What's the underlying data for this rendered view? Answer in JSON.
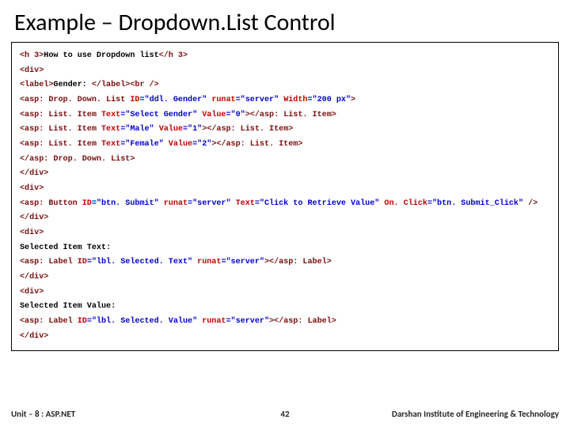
{
  "title": "Example – Dropdown.List Control",
  "footer": {
    "left": "Unit – 8 : ASP.NET",
    "center": "42",
    "right": "Darshan Institute of Engineering & Technology"
  },
  "code": {
    "lines": [
      [
        {
          "c": "tag",
          "t": "<h 3>"
        },
        {
          "c": "txt",
          "t": "How to use Dropdown list"
        },
        {
          "c": "tag",
          "t": "</h 3>"
        }
      ],
      [
        {
          "c": "tag",
          "t": "<div>"
        }
      ],
      [
        {
          "c": "tag",
          "t": "<label>"
        },
        {
          "c": "txt",
          "t": "Gender: "
        },
        {
          "c": "tag",
          "t": "</label><br />"
        }
      ],
      [
        {
          "c": "tag",
          "t": "<asp: Drop. Down. List "
        },
        {
          "c": "attr",
          "t": "ID"
        },
        {
          "c": "val",
          "t": "=\"ddl. Gender\" "
        },
        {
          "c": "attr",
          "t": "runat"
        },
        {
          "c": "val",
          "t": "=\"server\" "
        },
        {
          "c": "attr",
          "t": "Width"
        },
        {
          "c": "val",
          "t": "=\"200 px\""
        },
        {
          "c": "tag",
          "t": ">"
        }
      ],
      [
        {
          "c": "tag",
          "t": "<asp: List. Item "
        },
        {
          "c": "attr",
          "t": "Text"
        },
        {
          "c": "val",
          "t": "=\"Select Gender\" "
        },
        {
          "c": "attr",
          "t": "Value"
        },
        {
          "c": "val",
          "t": "=\"0\""
        },
        {
          "c": "tag",
          "t": "></asp: List. Item>"
        }
      ],
      [
        {
          "c": "tag",
          "t": "<asp: List. Item "
        },
        {
          "c": "attr",
          "t": "Text"
        },
        {
          "c": "val",
          "t": "=\"Male\" "
        },
        {
          "c": "attr",
          "t": "Value"
        },
        {
          "c": "val",
          "t": "=\"1\""
        },
        {
          "c": "tag",
          "t": "></asp: List. Item>"
        }
      ],
      [
        {
          "c": "tag",
          "t": "<asp: List. Item "
        },
        {
          "c": "attr",
          "t": "Text"
        },
        {
          "c": "val",
          "t": "=\"Female\" "
        },
        {
          "c": "attr",
          "t": "Value"
        },
        {
          "c": "val",
          "t": "=\"2\""
        },
        {
          "c": "tag",
          "t": "></asp: List. Item>"
        }
      ],
      [
        {
          "c": "tag",
          "t": "</asp: Drop. Down. List>"
        }
      ],
      [
        {
          "c": "tag",
          "t": "</div>"
        }
      ],
      [
        {
          "c": "tag",
          "t": "<div>"
        }
      ],
      [
        {
          "c": "tag",
          "t": "<asp: Button "
        },
        {
          "c": "attr",
          "t": "ID"
        },
        {
          "c": "val",
          "t": "=\"btn. Submit\" "
        },
        {
          "c": "attr",
          "t": "runat"
        },
        {
          "c": "val",
          "t": "=\"server\" "
        },
        {
          "c": "attr",
          "t": "Text"
        },
        {
          "c": "val",
          "t": "=\"Click to Retrieve Value\" "
        },
        {
          "c": "attr",
          "t": "On. Click"
        },
        {
          "c": "val",
          "t": "=\"btn. Submit_Click\" "
        },
        {
          "c": "tag",
          "t": "/>"
        }
      ],
      [
        {
          "c": "tag",
          "t": "</div>"
        }
      ],
      [
        {
          "c": "tag",
          "t": "<div>"
        }
      ],
      [
        {
          "c": "txt",
          "t": "Selected Item Text:"
        }
      ],
      [
        {
          "c": "tag",
          "t": "<asp: Label "
        },
        {
          "c": "attr",
          "t": "ID"
        },
        {
          "c": "val",
          "t": "=\"lbl. Selected. Text\" "
        },
        {
          "c": "attr",
          "t": "runat"
        },
        {
          "c": "val",
          "t": "=\"server\""
        },
        {
          "c": "tag",
          "t": "></asp: Label>"
        }
      ],
      [
        {
          "c": "tag",
          "t": "</div>"
        }
      ],
      [
        {
          "c": "tag",
          "t": "<div>"
        }
      ],
      [
        {
          "c": "txt",
          "t": "Selected Item Value:"
        }
      ],
      [
        {
          "c": "tag",
          "t": "<asp: Label "
        },
        {
          "c": "attr",
          "t": "ID"
        },
        {
          "c": "val",
          "t": "=\"lbl. Selected. Value\" "
        },
        {
          "c": "attr",
          "t": "runat"
        },
        {
          "c": "val",
          "t": "=\"server\""
        },
        {
          "c": "tag",
          "t": "></asp: Label>"
        }
      ],
      [
        {
          "c": "tag",
          "t": "</div>"
        }
      ]
    ]
  }
}
